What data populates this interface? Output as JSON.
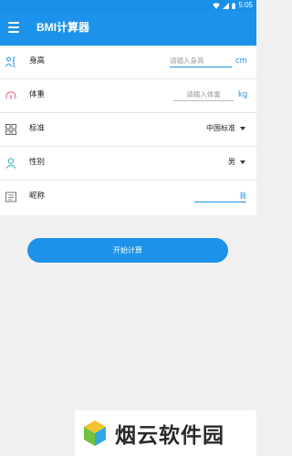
{
  "status_bar": {
    "time": "5:05"
  },
  "app_bar": {
    "title": "BMI计算器"
  },
  "form": {
    "height": {
      "label": "身高",
      "placeholder": "请输入身高",
      "unit": "cm"
    },
    "weight": {
      "label": "体重",
      "placeholder": "请输入体重",
      "unit": "kg"
    },
    "standard": {
      "label": "标准",
      "value": "中国标准"
    },
    "gender": {
      "label": "性别",
      "value": "男"
    },
    "nickname": {
      "label": "昵称",
      "value": "我"
    }
  },
  "actions": {
    "start_label": "开始计算"
  },
  "watermark": {
    "text": "烟云软件园"
  },
  "colors": {
    "accent": "#1d92ea",
    "status_bar": "#1a8fe6",
    "weight_icon": "#e8566b",
    "gender_icon": "#2bb3c0"
  }
}
